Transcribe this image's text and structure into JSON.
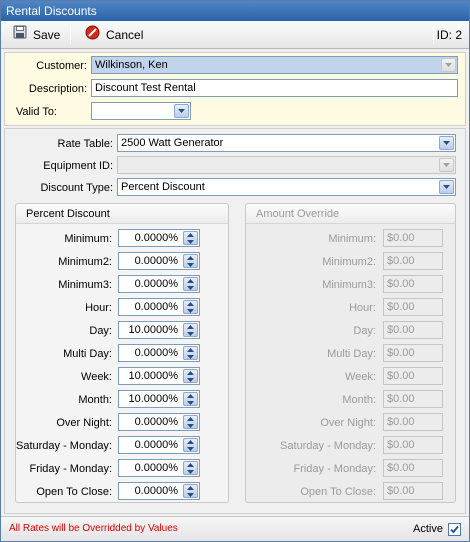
{
  "window": {
    "title": "Rental Discounts"
  },
  "toolbar": {
    "save_label": "Save",
    "cancel_label": "Cancel",
    "id_label": "ID: 2"
  },
  "header": {
    "customer_label": "Customer:",
    "customer_value": "Wilkinson, Ken",
    "description_label": "Description:",
    "description_value": "Discount Test Rental",
    "valid_to_label": "Valid To:",
    "valid_to_value": ""
  },
  "settings": {
    "rate_table_label": "Rate Table:",
    "rate_table_value": "2500 Watt Generator",
    "equipment_id_label": "Equipment ID:",
    "equipment_id_value": "",
    "discount_type_label": "Discount Type:",
    "discount_type_value": "Percent Discount"
  },
  "percent_group": {
    "title": "Percent Discount",
    "rows": [
      {
        "label": "Minimum:",
        "value": "0.0000%"
      },
      {
        "label": "Minimum2:",
        "value": "0.0000%"
      },
      {
        "label": "Minimum3:",
        "value": "0.0000%"
      },
      {
        "label": "Hour:",
        "value": "0.0000%"
      },
      {
        "label": "Day:",
        "value": "10.0000%"
      },
      {
        "label": "Multi Day:",
        "value": "0.0000%"
      },
      {
        "label": "Week:",
        "value": "10.0000%"
      },
      {
        "label": "Month:",
        "value": "10.0000%"
      },
      {
        "label": "Over Night:",
        "value": "0.0000%"
      },
      {
        "label": "Saturday - Monday:",
        "value": "0.0000%"
      },
      {
        "label": "Friday - Monday:",
        "value": "0.0000%"
      },
      {
        "label": "Open To Close:",
        "value": "0.0000%"
      }
    ]
  },
  "amount_group": {
    "title": "Amount Override",
    "rows": [
      {
        "label": "Minimum:",
        "value": "$0.00"
      },
      {
        "label": "Minimum2:",
        "value": "$0.00"
      },
      {
        "label": "Minimum3:",
        "value": "$0.00"
      },
      {
        "label": "Hour:",
        "value": "$0.00"
      },
      {
        "label": "Day:",
        "value": "$0.00"
      },
      {
        "label": "Multi Day:",
        "value": "$0.00"
      },
      {
        "label": "Week:",
        "value": "$0.00"
      },
      {
        "label": "Month:",
        "value": "$0.00"
      },
      {
        "label": "Over Night:",
        "value": "$0.00"
      },
      {
        "label": "Saturday - Monday:",
        "value": "$0.00"
      },
      {
        "label": "Friday - Monday:",
        "value": "$0.00"
      },
      {
        "label": "Open To Close:",
        "value": "$0.00"
      }
    ]
  },
  "status": {
    "message": "All Rates will be Overridded by Values",
    "active_label": "Active",
    "active_checked": true
  },
  "colors": {
    "title_bar": "#3a72b8",
    "warning_text": "#e00000",
    "info_panel": "#fffbe3"
  },
  "icons": {
    "save": "floppy-disk-icon",
    "cancel": "cancel-icon",
    "dropdown": "chevron-down-icon",
    "spinner": "spin-arrows-icon",
    "check": "checkmark-icon"
  }
}
